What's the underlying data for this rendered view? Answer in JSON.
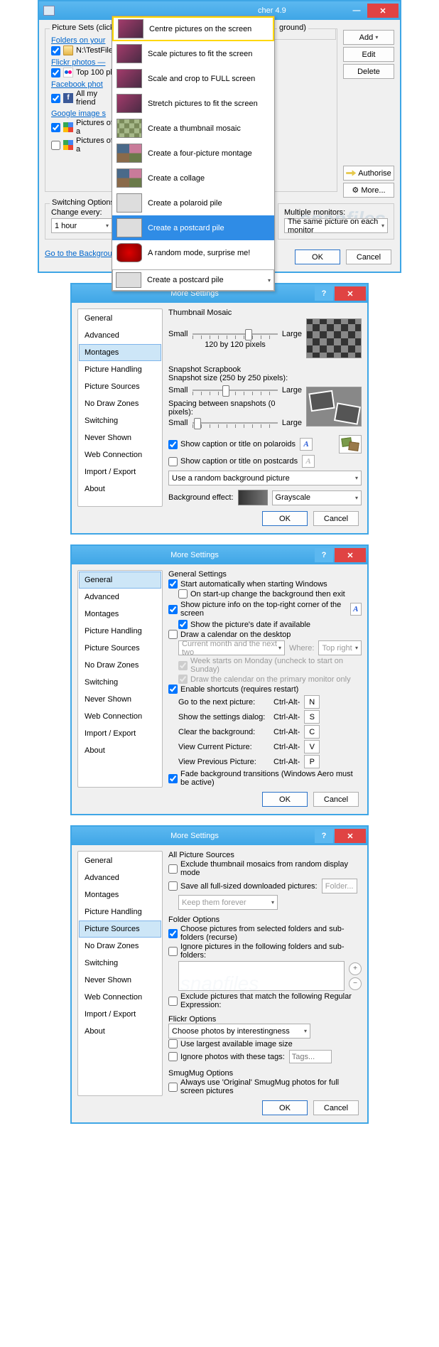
{
  "watermark": "snapfiles",
  "w1": {
    "title": "cher 4.9",
    "sets_header": "Picture Sets (click '",
    "folders": {
      "header": "Folders on your",
      "item": "N:\\TestFiles"
    },
    "flickr": {
      "header": "Flickr photos —",
      "item": "Top 100 ph"
    },
    "facebook": {
      "header": "Facebook phot",
      "item": "All my friend"
    },
    "google": {
      "header": "Google image s",
      "item1": "Pictures of a",
      "item2": "Pictures of a"
    },
    "add": "Add",
    "edit": "Edit",
    "delete": "Delete",
    "authorise": "Authorise",
    "more": "More...",
    "dd": {
      "i0": "Centre pictures on the screen",
      "i1": "Scale pictures to fit the screen",
      "i2": "Scale and crop to FULL screen",
      "i3": "Stretch pictures to fit the screen",
      "i4": "Create a thumbnail mosaic",
      "i5": "Create a four-picture montage",
      "i6": "Create a collage",
      "i7": "Create a polaroid pile",
      "i8": "Create a postcard pile",
      "i9": "A random mode, surprise me!",
      "cur": "Create a postcard pile"
    },
    "switch_header": "Switching Options",
    "change_every": "Change every:",
    "interval": "1 hour",
    "multi_header": "Multiple monitors:",
    "multi_val": "The same picture on each monitor",
    "legend": "ground)",
    "homepage": "Go to the Background Switcher homepage",
    "ok": "OK",
    "cancel": "Cancel"
  },
  "nav": {
    "general": "General",
    "advanced": "Advanced",
    "montages": "Montages",
    "pic_handling": "Picture Handling",
    "pic_sources": "Picture Sources",
    "no_draw": "No Draw Zones",
    "switching": "Switching",
    "never_shown": "Never Shown",
    "web_conn": "Web Connection",
    "import_export": "Import / Export",
    "about": "About"
  },
  "more_title": "More Settings",
  "w2": {
    "tm": "Thumbnail Mosaic",
    "small": "Small",
    "large": "Large",
    "tm_size": "120 by 120 pixels",
    "ss": "Snapshot Scrapbook",
    "ss_size": "Snapshot size (250 by 250 pixels):",
    "ss_spacing": "Spacing between snapshots (0 pixels):",
    "cap_pol": "Show caption or title on polaroids",
    "cap_post": "Show caption or title on postcards",
    "random_bg": "Use a random background picture",
    "bg_effect": "Background effect:",
    "bg_val": "Grayscale",
    "ok": "OK",
    "cancel": "Cancel"
  },
  "w3": {
    "gs": "General Settings",
    "start_auto": "Start automatically when starting Windows",
    "start_exit": "On start-up change the background then exit",
    "show_info": "Show picture info on the top-right corner of the screen",
    "show_date": "Show the picture's date if available",
    "draw_cal": "Draw a calendar on the desktop",
    "cal_range": "Current month and the next two",
    "where": "Where:",
    "where_val": "Top right",
    "week_mon": "Week starts on Monday (uncheck to start on Sunday)",
    "cal_primary": "Draw the calendar on the primary monitor only",
    "enable_sc": "Enable shortcuts (requires restart)",
    "sc_next": "Go to the next picture:",
    "sc_settings": "Show the settings dialog:",
    "sc_clear": "Clear the background:",
    "sc_view": "View Current Picture:",
    "sc_prev": "View Previous Picture:",
    "ctrlalt": "Ctrl-Alt-",
    "k_n": "N",
    "k_s": "S",
    "k_c": "C",
    "k_v": "V",
    "k_p": "P",
    "fade": "Fade background transitions (Windows Aero must be active)",
    "ok": "OK",
    "cancel": "Cancel"
  },
  "w4": {
    "aps": "All Picture Sources",
    "excl_mosaic": "Exclude thumbnail mosaics from random display mode",
    "save_full": "Save all full-sized downloaded pictures:",
    "folder": "Folder...",
    "keep": "Keep them forever",
    "fo": "Folder Options",
    "recurse": "Choose pictures from selected folders and sub-folders (recurse)",
    "ignore_folders": "Ignore pictures in the following folders and sub-folders:",
    "excl_regex": "Exclude pictures that match the following Regular Expression:",
    "flo": "Flickr Options",
    "flo_sort": "Choose photos by interestingness",
    "use_largest": "Use largest available image size",
    "ignore_tags": "Ignore photos with these tags:",
    "tags_ph": "Tags...",
    "smug": "SmugMug Options",
    "smug_opt": "Always use 'Original' SmugMug photos for full screen pictures",
    "ok": "OK",
    "cancel": "Cancel"
  }
}
